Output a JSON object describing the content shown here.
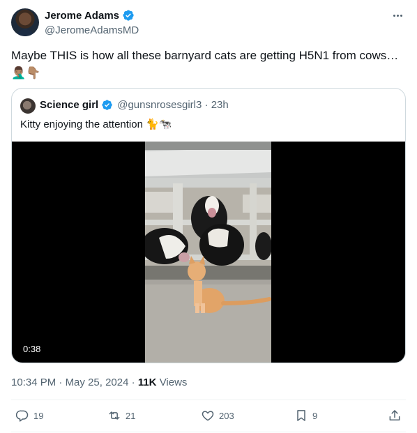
{
  "author": {
    "display_name": "Jerome Adams",
    "handle": "@JeromeAdamsMD",
    "verified": true
  },
  "tweet": {
    "text": "Maybe THIS is how all these barnyard cats are getting H5N1 from cows…",
    "emojis": "🤦🏽‍♂️👇🏽"
  },
  "quote": {
    "display_name": "Science girl",
    "handle": "@gunsnrosesgirl3",
    "time": "23h",
    "separator": "·",
    "text": "Kitty enjoying the attention",
    "emojis": "🐈🐄",
    "video_duration": "0:38"
  },
  "meta": {
    "time": "10:34 PM",
    "date": "May 25, 2024",
    "separator": "·",
    "views_count": "11K",
    "views_label": "Views"
  },
  "actions": {
    "replies": "19",
    "reposts": "21",
    "likes": "203",
    "bookmarks": "9"
  },
  "colors": {
    "text_primary": "#0f1419",
    "text_secondary": "#536471",
    "verified_blue": "#1d9bf0",
    "border": "#cfd9de"
  },
  "icons": [
    "verified-badge-icon",
    "more-icon",
    "reply-icon",
    "repost-icon",
    "like-icon",
    "bookmark-icon",
    "share-icon"
  ]
}
